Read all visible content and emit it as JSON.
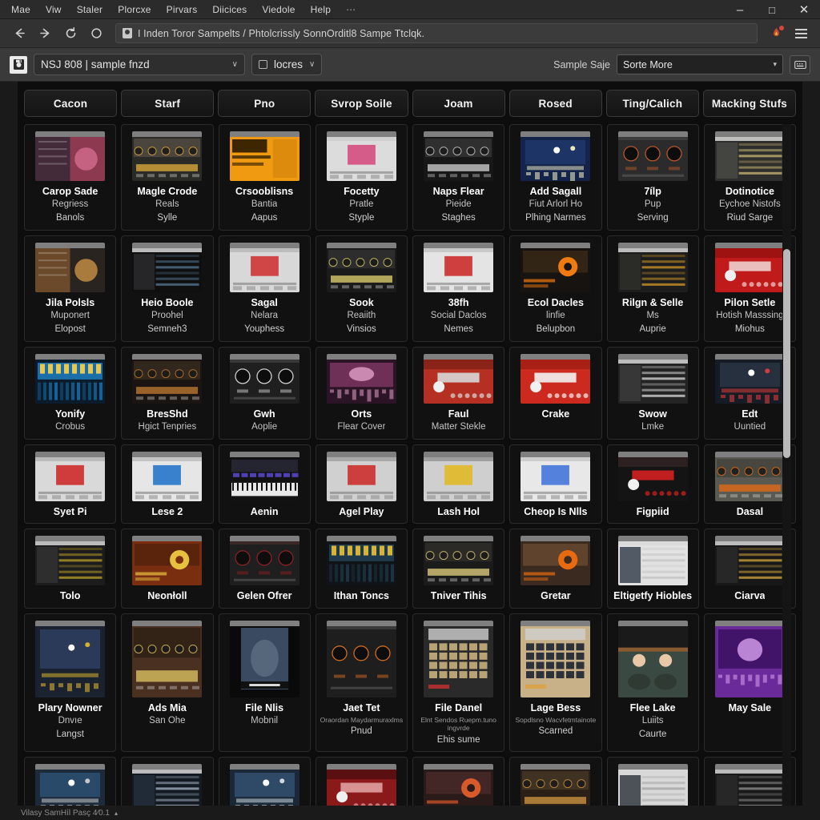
{
  "window": {
    "menu_items": [
      "Mae",
      "Viw",
      "Staler",
      "Plorcxe",
      "Pirvars",
      "Diicices",
      "Viedole",
      "Help"
    ],
    "menu_overflow": "⋯",
    "minimize": "–",
    "maximize": "□",
    "close": "✕"
  },
  "navbar": {
    "back_icon": "back-arrow-icon",
    "forward_icon": "forward-arrow-icon",
    "reload_icon": "reload-icon",
    "stop_icon": "stop-icon",
    "lock_icon": "lock-icon",
    "url": "I Inden Toror Sampelts / Phtolcrissly SonnOrditl8 Sampe Ttclqk.",
    "extension_icon": "extension-icon",
    "menu_icon": "hamburger-menu-icon"
  },
  "toolbar": {
    "app_icon": "app-logo-icon",
    "library_value": "NSJ 808 | sample fnzd",
    "library_caret": "∨",
    "filter_value": "locres",
    "filter_caret": "∨",
    "sample_label": "Sample Saje",
    "sort_value": "Sorte More",
    "sort_caret": "▾",
    "view_icon": "keyboard-icon"
  },
  "tabs": [
    "Cacon",
    "Starf",
    "Pno",
    "Svrop Soile",
    "Joam",
    "Rosed",
    "Ting/Calich",
    "Macking Stufs"
  ],
  "grid": {
    "rows": [
      {
        "tall": false,
        "items": [
          {
            "title": "Carop Sade",
            "sub": "Regriess",
            "sub2": "Banols",
            "c1": "#8d3a50",
            "c2": "#442b3a",
            "c3": "#d06a8a",
            "style": "split"
          },
          {
            "title": "Magle Crode",
            "sub": "Reals",
            "sub2": "Sylle",
            "c1": "#2a2a26",
            "c2": "#595248",
            "c3": "#d8a63c",
            "style": "rack"
          },
          {
            "title": "Crsooblisns",
            "sub": "Bantia",
            "sub2": "Aapus",
            "c1": "#f09a12",
            "c2": "#c97b08",
            "c3": "#2a1a00",
            "style": "flat"
          },
          {
            "title": "Focetty",
            "sub": "Pratle",
            "sub2": "Styple",
            "c1": "#dcdcdc",
            "c2": "#cfcfcf",
            "c3": "#d3457a",
            "style": "light"
          },
          {
            "title": "Naps Flear",
            "sub": "Pieide",
            "sub2": "Staghes",
            "c1": "#171717",
            "c2": "#3a3a3a",
            "c3": "#c8c8c8",
            "style": "rack"
          },
          {
            "title": "Add Sagall",
            "sub": "Fiut Arlorl Ho",
            "sub2": "Plhing Narmes",
            "c1": "#14234a",
            "c2": "#1d3566",
            "c3": "#e8e8c0",
            "style": "blue"
          },
          {
            "title": "7ílp",
            "sub": "Pup",
            "sub2": "Serving",
            "c1": "#2b2b2b",
            "c2": "#3d3d3d",
            "c3": "#b5572a",
            "style": "knobs"
          },
          {
            "title": "Dotinotice",
            "sub": "Eychoe Nistofs",
            "sub2": "Riud Sarge",
            "c1": "#2e2e2c",
            "c2": "#4a4a46",
            "c3": "#d6c27a",
            "style": "daw"
          }
        ]
      },
      {
        "tall": false,
        "items": [
          {
            "title": "Jila Polsls",
            "sub": "Muponert",
            "sub2": "Elopost",
            "c1": "#2a2420",
            "c2": "#6a4a2a",
            "c3": "#c08c44",
            "style": "split"
          },
          {
            "title": "Heio Boole",
            "sub": "Proohel",
            "sub2": "Semneh3",
            "c1": "#0f0f0f",
            "c2": "#2c2c30",
            "c3": "#5a7f9c",
            "style": "daw"
          },
          {
            "title": "Sagal",
            "sub": "Nelara",
            "sub2": "Youphess",
            "c1": "#d8d8d8",
            "c2": "#bdbdbd",
            "c3": "#cf2b2b",
            "style": "light"
          },
          {
            "title": "Sook",
            "sub": "Reaiith",
            "sub2": "Vinsios",
            "c1": "#1b1b1b",
            "c2": "#343434",
            "c3": "#d7c96a",
            "style": "rack"
          },
          {
            "title": "38fh",
            "sub": "Social Daclos",
            "sub2": "Nemes",
            "c1": "#e4e4e4",
            "c2": "#c9c9c9",
            "c3": "#cc2222",
            "style": "light"
          },
          {
            "title": "Ecol Dacles",
            "sub": "linfie",
            "sub2": "Belupbon",
            "c1": "#171310",
            "c2": "#3a2a18",
            "c3": "#ef7a10",
            "style": "orange"
          },
          {
            "title": "Rilgn & Selle",
            "sub": "Ms",
            "sub2": "Auprie",
            "c1": "#1d1d1d",
            "c2": "#30302c",
            "c3": "#e0a128",
            "style": "daw"
          },
          {
            "title": "Pilon Setle",
            "sub": "Hotish Masssing",
            "sub2": "Miohus",
            "c1": "#c11a1a",
            "c2": "#9e1212",
            "c3": "#f0d0d0",
            "style": "red"
          }
        ]
      },
      {
        "tall": false,
        "items": [
          {
            "title": "Yonify",
            "sub": "Crobus",
            "sub2": "",
            "c1": "#0a1c2c",
            "c2": "#1a6fa8",
            "c3": "#ffd24a",
            "style": "cyan"
          },
          {
            "title": "BresShd",
            "sub": "Hgict Tenpries",
            "sub2": "",
            "c1": "#1a1512",
            "c2": "#3d2f22",
            "c3": "#b8762e",
            "style": "rack"
          },
          {
            "title": "Gwh",
            "sub": "Aoplie",
            "sub2": "",
            "c1": "#1f1f1f",
            "c2": "#383838",
            "c3": "#cfcfcf",
            "style": "knobs"
          },
          {
            "title": "Orts",
            "sub": "Flear Cover",
            "sub2": "",
            "c1": "#2a1426",
            "c2": "#7a3560",
            "c3": "#e0a0c8",
            "style": "purple"
          },
          {
            "title": "Faul",
            "sub": "Matter Stekle",
            "sub2": "",
            "c1": "#b53022",
            "c2": "#8a2418",
            "c3": "#d8d8d8",
            "style": "red"
          },
          {
            "title": "Crake",
            "sub": "",
            "sub2": "",
            "c1": "#cc2a1e",
            "c2": "#a81f16",
            "c3": "#f2f2f2",
            "style": "red"
          },
          {
            "title": "Swow",
            "sub": "Lmke",
            "sub2": "",
            "c1": "#242424",
            "c2": "#3c3c3c",
            "c3": "#e8e8e8",
            "style": "daw"
          },
          {
            "title": "Edt",
            "sub": "Uuntied",
            "sub2": "",
            "c1": "#151c26",
            "c2": "#26303e",
            "c3": "#d83a3a",
            "style": "blue"
          }
        ]
      },
      {
        "tall": false,
        "items": [
          {
            "title": "Syet Pi",
            "sub": "",
            "sub2": "",
            "c1": "#d9d9d9",
            "c2": "#bababa",
            "c3": "#cc2020",
            "style": "light"
          },
          {
            "title": "Lese 2",
            "sub": "",
            "sub2": "",
            "c1": "#e6e6e6",
            "c2": "#c4c4c4",
            "c3": "#1a6fc8",
            "style": "light"
          },
          {
            "title": "Aenin",
            "sub": "",
            "sub2": "",
            "c1": "#121212",
            "c2": "#2a2a3a",
            "c3": "#5a4ad0",
            "style": "keys"
          },
          {
            "title": "Agel Play",
            "sub": "",
            "sub2": "",
            "c1": "#d0d0d0",
            "c2": "#a8a8a8",
            "c3": "#cc2626",
            "style": "light"
          },
          {
            "title": "Lash Hol",
            "sub": "",
            "sub2": "",
            "c1": "#cfcfcf",
            "c2": "#9f9f9f",
            "c3": "#e0b81c",
            "style": "light"
          },
          {
            "title": "Cheop Is Nlls",
            "sub": "",
            "sub2": "",
            "c1": "#e8e8e8",
            "c2": "#cccccc",
            "c3": "#3a6fd8",
            "style": "light"
          },
          {
            "title": "Figpiid",
            "sub": "",
            "sub2": "",
            "c1": "#141414",
            "c2": "#2c2020",
            "c3": "#d42020",
            "style": "red"
          },
          {
            "title": "Dasal",
            "sub": "",
            "sub2": "",
            "c1": "#5a5a52",
            "c2": "#3e3e38",
            "c3": "#e06a18",
            "style": "rack"
          }
        ]
      },
      {
        "tall": false,
        "items": [
          {
            "title": "Tolo",
            "sub": "",
            "sub2": "",
            "c1": "#1c1c1c",
            "c2": "#333333",
            "c3": "#c8a828",
            "style": "daw"
          },
          {
            "title": "Neonłoll",
            "sub": "",
            "sub2": "",
            "c1": "#7a2e10",
            "c2": "#53200a",
            "c3": "#e8c040",
            "style": "orange"
          },
          {
            "title": "Gelen Ofrer",
            "sub": "",
            "sub2": "",
            "c1": "#1f1f1f",
            "c2": "#3a2828",
            "c3": "#8b2020",
            "style": "knobs"
          },
          {
            "title": "Ithan Toncs",
            "sub": "",
            "sub2": "",
            "c1": "#101418",
            "c2": "#1e3a4a",
            "c3": "#e8c23a",
            "style": "cyan"
          },
          {
            "title": "Tniver Tihis",
            "sub": "",
            "sub2": "",
            "c1": "#1b1b1b",
            "c2": "#32312c",
            "c3": "#d8c87a",
            "style": "rack"
          },
          {
            "title": "Gretar",
            "sub": "",
            "sub2": "",
            "c1": "#3a2a20",
            "c2": "#6a4a30",
            "c3": "#e86a10",
            "style": "orange"
          },
          {
            "title": "Eltigetfy Hiobles",
            "sub": "",
            "sub2": "",
            "c1": "#e2e2e2",
            "c2": "#2e3846",
            "c3": "#c0c0c0",
            "style": "daw"
          },
          {
            "title": "Ciarva",
            "sub": "",
            "sub2": "",
            "c1": "#181818",
            "c2": "#2c2c2c",
            "c3": "#e0b040",
            "style": "daw"
          }
        ]
      },
      {
        "tall": true,
        "items": [
          {
            "title": "Plary Nowner",
            "sub": "Dnvıe",
            "sub2": "Langst",
            "c1": "#1a2230",
            "c2": "#2a3a58",
            "c3": "#d8b030",
            "style": "blue"
          },
          {
            "title": "Ads Mia",
            "sub": "San Ohe",
            "sub2": "",
            "c1": "#4a3020",
            "c2": "#2a1c12",
            "c3": "#d8c060",
            "style": "rack"
          },
          {
            "title": "File Nlis",
            "sub": "Mobnil",
            "sub2": "",
            "c1": "#3a4a60",
            "c2": "#5a6a80",
            "c3": "#d8d8d8",
            "style": "poster"
          },
          {
            "title": "Jaet Tet",
            "sub": "Oraordan Maydarmuraxlms",
            "sub2": "Pnud",
            "c1": "#1e1e1e",
            "c2": "#3a3a3a",
            "c3": "#d06a20",
            "style": "knobs"
          },
          {
            "title": "File Danel",
            "sub": "Elnt Sendos Ruepm.tuno ingvrde",
            "sub2": "Ehis sume",
            "c1": "#2a2a2a",
            "c2": "#c8b080",
            "c3": "#cc3030",
            "style": "pads"
          },
          {
            "title": "Lage Bess",
            "sub": "Sopdlsno Wacvfetmtainote",
            "sub2": "Scarned",
            "c1": "#c8b088",
            "c2": "#1c2430",
            "c3": "#e0a040",
            "style": "pads"
          },
          {
            "title": "Flee Lake",
            "sub": "Luiits",
            "sub2": "Caurte",
            "c1": "#e8e8e8",
            "c2": "#3a4a42",
            "c3": "#8a5a30",
            "style": "faces"
          },
          {
            "title": "May Sale",
            "sub": "",
            "sub2": "",
            "c1": "#6a2a9a",
            "c2": "#3a1060",
            "c3": "#d8a0f0",
            "style": "purple"
          }
        ]
      },
      {
        "tall": false,
        "items": [
          {
            "title": "",
            "sub": "",
            "sub2": "",
            "c1": "#1c2a3a",
            "c2": "#2a4a6a",
            "c3": "#c8c8c8",
            "style": "blue"
          },
          {
            "title": "",
            "sub": "",
            "sub2": "",
            "c1": "#141a22",
            "c2": "#24303e",
            "c3": "#b0c0d0",
            "style": "daw"
          },
          {
            "title": "",
            "sub": "",
            "sub2": "",
            "c1": "#1a2838",
            "c2": "#2e4a66",
            "c3": "#d0d8e0",
            "style": "blue"
          },
          {
            "title": "",
            "sub": "",
            "sub2": "",
            "c1": "#8a1a1a",
            "c2": "#5a1010",
            "c3": "#e0a0a0",
            "style": "red"
          },
          {
            "title": "",
            "sub": "",
            "sub2": "",
            "c1": "#2a1a1a",
            "c2": "#4a2a2a",
            "c3": "#d85a2a",
            "style": "orange"
          },
          {
            "title": "",
            "sub": "",
            "sub2": "",
            "c1": "#2a2018",
            "c2": "#4a3a28",
            "c3": "#c89040",
            "style": "rack"
          },
          {
            "title": "",
            "sub": "",
            "sub2": "",
            "c1": "#d8d8d8",
            "c2": "#2a3038",
            "c3": "#a0a0a0",
            "style": "daw"
          },
          {
            "title": "",
            "sub": "",
            "sub2": "",
            "c1": "#1a1a1a",
            "c2": "#2a2a2a",
            "c3": "#9a9a9a",
            "style": "daw"
          }
        ]
      }
    ]
  },
  "statusbar": {
    "text": "Vilasy SamHíl Pasç 4⁄0.1",
    "caret": "▴"
  }
}
